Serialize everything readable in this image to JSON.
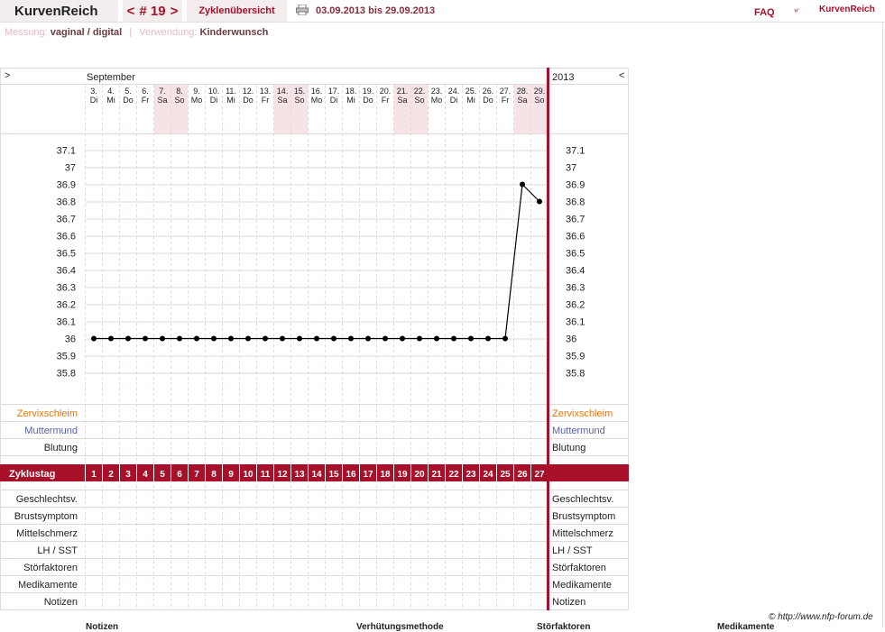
{
  "header": {
    "brand": "KurvenReich",
    "cycle_prev": "<",
    "cycle_label": "# 19",
    "cycle_next": ">",
    "overview": "Zyklenübersicht",
    "date_range": "03.09.2013 bis 29.09.2013",
    "faq": "FAQ",
    "logo_text": "KurvenReich"
  },
  "subbar": {
    "measure_label": "Messung:",
    "measure_value": "vaginal / digital",
    "separator": "|",
    "use_label": "Verwendung:",
    "use_value": "Kinderwunsch"
  },
  "chart": {
    "nav_left": ">",
    "nav_right": "<",
    "month": "September",
    "year": "2013",
    "dates": [
      "3.",
      "4.",
      "5.",
      "6.",
      "7.",
      "8.",
      "9.",
      "10.",
      "11.",
      "12.",
      "13.",
      "14.",
      "15.",
      "16.",
      "17.",
      "18.",
      "19.",
      "20.",
      "21.",
      "22.",
      "23.",
      "24.",
      "25.",
      "26.",
      "27.",
      "28.",
      "29."
    ],
    "weekdays": [
      "Di",
      "Mi",
      "Do",
      "Fr",
      "Sa",
      "So",
      "Mo",
      "Di",
      "Mi",
      "Do",
      "Fr",
      "Sa",
      "So",
      "Mo",
      "Di",
      "Mi",
      "Do",
      "Fr",
      "Sa",
      "So",
      "Mo",
      "Di",
      "Mi",
      "Do",
      "Fr",
      "Sa",
      "So"
    ],
    "weekend_indices": [
      4,
      5,
      11,
      12,
      18,
      19,
      25,
      26
    ],
    "row_labels_left": {
      "zervix": "Zervixschleim",
      "muttermund": "Muttermund",
      "blutung": "Blutung"
    },
    "cycle_row_label": "Zyklustag",
    "cycle_days": [
      "1",
      "2",
      "3",
      "4",
      "5",
      "6",
      "7",
      "8",
      "9",
      "10",
      "11",
      "12",
      "13",
      "14",
      "15",
      "16",
      "17",
      "18",
      "19",
      "20",
      "21",
      "22",
      "23",
      "24",
      "25",
      "26",
      "27"
    ],
    "bottom_rows": [
      "Geschlechtsv.",
      "Brustsymptom",
      "Mittelschmerz",
      "LH / SST",
      "Störfaktoren",
      "Medikamente",
      "Notizen"
    ],
    "colors": {
      "accent": "#a8102a",
      "zervix": "#e8760c",
      "muttermund": "#5561b0",
      "weekend": "#f6e3e6",
      "grid": "#e2dada"
    }
  },
  "chart_data": {
    "type": "line",
    "x": [
      "3.",
      "4.",
      "5.",
      "6.",
      "7.",
      "8.",
      "9.",
      "10.",
      "11.",
      "12.",
      "13.",
      "14.",
      "15.",
      "16.",
      "17.",
      "18.",
      "19.",
      "20.",
      "21.",
      "22.",
      "23.",
      "24.",
      "25.",
      "26.",
      "27.",
      "28.",
      "29."
    ],
    "series": [
      {
        "values": [
          36.0,
          36.0,
          36.0,
          36.0,
          36.0,
          36.0,
          36.0,
          36.0,
          36.0,
          36.0,
          36.0,
          36.0,
          36.0,
          36.0,
          36.0,
          36.0,
          36.0,
          36.0,
          36.0,
          36.0,
          36.0,
          36.0,
          36.0,
          36.0,
          36.0,
          36.9,
          36.8
        ]
      }
    ],
    "yticks": [
      "37.1",
      "37",
      "36.9",
      "36.8",
      "36.7",
      "36.6",
      "36.5",
      "36.4",
      "36.3",
      "36.2",
      "36.1",
      "36",
      "35.9",
      "35.8"
    ],
    "ylim": [
      35.8,
      37.1
    ],
    "grid": true
  },
  "footer": {
    "credit": "© http://www.nfp-forum.de",
    "cols": [
      "Notizen",
      "Verhütungsmethode",
      "Störfaktoren",
      "Medikamente"
    ]
  }
}
